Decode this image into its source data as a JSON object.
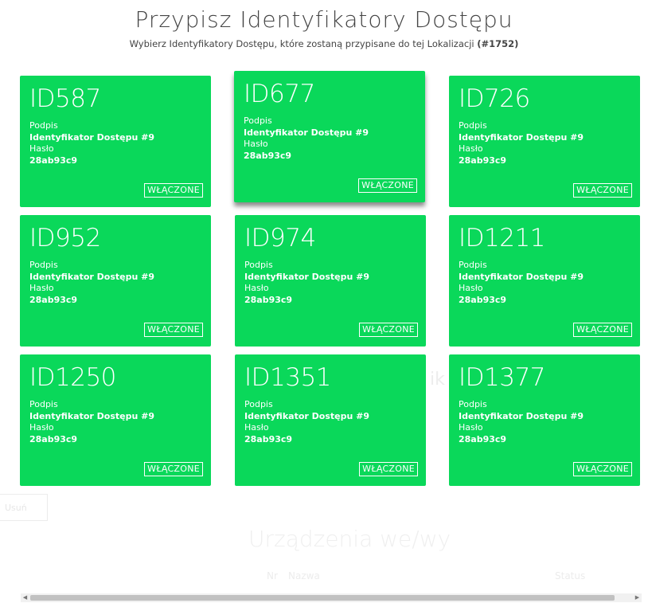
{
  "header": {
    "title": "Przypisz Identyfikatory Dostępu",
    "subtitle": "Wybierz Identyfikatory Dostępu, które zostaną przypisane do tej Lokalizacji",
    "location_id": "(#1752)"
  },
  "cards": [
    {
      "id": "ID587",
      "sig_label": "Podpis",
      "sig_value": "Identyfikator Dostępu #9",
      "pass_label": "Hasło",
      "pass_value": "28ab93c9",
      "status": "WŁĄCZONE"
    },
    {
      "id": "ID677",
      "sig_label": "Podpis",
      "sig_value": "Identyfikator Dostępu #9",
      "pass_label": "Hasło",
      "pass_value": "28ab93c9",
      "status": "WŁĄCZONE"
    },
    {
      "id": "ID726",
      "sig_label": "Podpis",
      "sig_value": "Identyfikator Dostępu #9",
      "pass_label": "Hasło",
      "pass_value": "28ab93c9",
      "status": "WŁĄCZONE"
    },
    {
      "id": "ID952",
      "sig_label": "Podpis",
      "sig_value": "Identyfikator Dostępu #9",
      "pass_label": "Hasło",
      "pass_value": "28ab93c9",
      "status": "WŁĄCZONE"
    },
    {
      "id": "ID974",
      "sig_label": "Podpis",
      "sig_value": "Identyfikator Dostępu #9",
      "pass_label": "Hasło",
      "pass_value": "28ab93c9",
      "status": "WŁĄCZONE"
    },
    {
      "id": "ID1211",
      "sig_label": "Podpis",
      "sig_value": "Identyfikator Dostępu #9",
      "pass_label": "Hasło",
      "pass_value": "28ab93c9",
      "status": "WŁĄCZONE"
    },
    {
      "id": "ID1250",
      "sig_label": "Podpis",
      "sig_value": "Identyfikator Dostępu #9",
      "pass_label": "Hasło",
      "pass_value": "28ab93c9",
      "status": "WŁĄCZONE"
    },
    {
      "id": "ID1351",
      "sig_label": "Podpis",
      "sig_value": "Identyfikator Dostępu #9",
      "pass_label": "Hasło",
      "pass_value": "28ab93c9",
      "status": "WŁĄCZONE"
    },
    {
      "id": "ID1377",
      "sig_label": "Podpis",
      "sig_value": "Identyfikator Dostępu #9",
      "pass_label": "Hasło",
      "pass_value": "28ab93c9",
      "status": "WŁĄCZONE"
    }
  ],
  "background": {
    "section_title": "Urządzenia we/wy",
    "col_nr": "Nr",
    "col_name": "Nazwa",
    "col_status": "Status",
    "button_label": "Usuń",
    "fragment": "ik"
  },
  "colors": {
    "card_bg": "#0ad85a",
    "card_text": "#ffffff"
  }
}
